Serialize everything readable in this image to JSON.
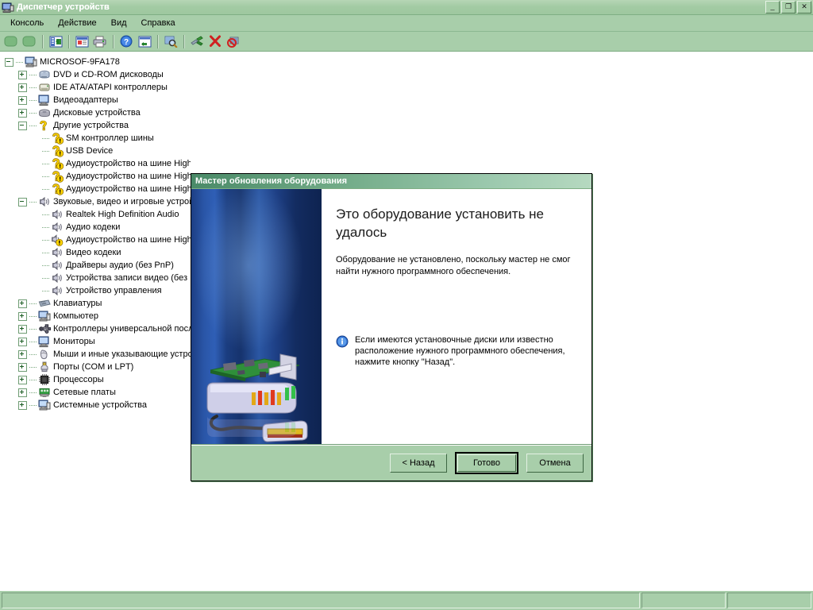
{
  "window": {
    "title": "Диспетчер устройств",
    "icon": "device-manager-icon",
    "buttons": {
      "minimize": "_",
      "restore": "❐",
      "close": "✕"
    }
  },
  "menubar": {
    "items": [
      {
        "label": "Консоль"
      },
      {
        "label": "Действие"
      },
      {
        "label": "Вид"
      },
      {
        "label": "Справка"
      }
    ]
  },
  "toolbar": {
    "buttons": [
      {
        "name": "back-button",
        "icon": "back-arrow-icon"
      },
      {
        "name": "forward-button",
        "icon": "forward-arrow-icon"
      },
      {
        "name": "show-console-tree-button",
        "icon": "console-tree-icon"
      },
      {
        "name": "properties-button",
        "icon": "properties-icon"
      },
      {
        "name": "print-button",
        "icon": "printer-icon"
      },
      {
        "name": "help-button",
        "icon": "help-icon"
      },
      {
        "name": "refresh-view-button",
        "icon": "refresh-view-icon"
      },
      {
        "name": "scan-hardware-button",
        "icon": "scan-hardware-icon"
      },
      {
        "name": "update-driver-button",
        "icon": "update-driver-icon"
      },
      {
        "name": "uninstall-button",
        "icon": "red-x-icon"
      },
      {
        "name": "disable-button",
        "icon": "disable-icon"
      }
    ]
  },
  "tree": {
    "root": {
      "label": "MICROSOF-9FA178",
      "icon": "computer-icon",
      "expanded": true
    },
    "nodes": [
      {
        "label": "DVD и CD-ROM дисководы",
        "icon": "cdrom-icon",
        "level": 1,
        "expander": "plus"
      },
      {
        "label": "IDE ATA/ATAPI контроллеры",
        "icon": "ide-icon",
        "level": 1,
        "expander": "plus"
      },
      {
        "label": "Видеоадаптеры",
        "icon": "display-icon",
        "level": 1,
        "expander": "plus"
      },
      {
        "label": "Дисковые устройства",
        "icon": "disk-icon",
        "level": 1,
        "expander": "plus"
      },
      {
        "label": "Другие устройства",
        "icon": "unknown-device-icon",
        "level": 1,
        "expander": "minus"
      },
      {
        "label": "SM контроллер шины",
        "icon": "warning-device-icon",
        "level": 2,
        "expander": "none"
      },
      {
        "label": "USB Device",
        "icon": "warning-device-icon",
        "level": 2,
        "expander": "none"
      },
      {
        "label": "Аудиоустройство на шине High I",
        "icon": "warning-device-icon",
        "level": 2,
        "expander": "none"
      },
      {
        "label": "Аудиоустройство на шине High I",
        "icon": "warning-device-icon",
        "level": 2,
        "expander": "none"
      },
      {
        "label": "Аудиоустройство на шине High I",
        "icon": "warning-device-icon",
        "level": 2,
        "expander": "none"
      },
      {
        "label": "Звуковые, видео и игровые устрой",
        "icon": "sound-icon",
        "level": 1,
        "expander": "minus"
      },
      {
        "label": "Realtek High Definition Audio",
        "icon": "sound-icon",
        "level": 2,
        "expander": "none"
      },
      {
        "label": "Аудио кодеки",
        "icon": "sound-icon",
        "level": 2,
        "expander": "none"
      },
      {
        "label": "Аудиоустройство на шине High I",
        "icon": "sound-warning-icon",
        "level": 2,
        "expander": "none"
      },
      {
        "label": "Видео кодеки",
        "icon": "sound-icon",
        "level": 2,
        "expander": "none"
      },
      {
        "label": "Драйверы аудио (без PnP)",
        "icon": "sound-icon",
        "level": 2,
        "expander": "none"
      },
      {
        "label": "Устройства записи видео (без I",
        "icon": "sound-icon",
        "level": 2,
        "expander": "none"
      },
      {
        "label": "Устройство управления",
        "icon": "sound-icon",
        "level": 2,
        "expander": "none"
      },
      {
        "label": "Клавиатуры",
        "icon": "keyboard-icon",
        "level": 1,
        "expander": "plus"
      },
      {
        "label": "Компьютер",
        "icon": "computer-icon",
        "level": 1,
        "expander": "plus"
      },
      {
        "label": "Контроллеры универсальной после",
        "icon": "usb-icon",
        "level": 1,
        "expander": "plus"
      },
      {
        "label": "Мониторы",
        "icon": "monitor-icon",
        "level": 1,
        "expander": "plus"
      },
      {
        "label": "Мыши и иные указывающие устрой",
        "icon": "mouse-icon",
        "level": 1,
        "expander": "plus"
      },
      {
        "label": "Порты (COM и LPT)",
        "icon": "port-icon",
        "level": 1,
        "expander": "plus"
      },
      {
        "label": "Процессоры",
        "icon": "processor-icon",
        "level": 1,
        "expander": "plus"
      },
      {
        "label": "Сетевые платы",
        "icon": "network-icon",
        "level": 1,
        "expander": "plus"
      },
      {
        "label": "Системные устройства",
        "icon": "system-device-icon",
        "level": 1,
        "expander": "plus"
      }
    ]
  },
  "dialog": {
    "title": "Мастер обновления оборудования",
    "heading": "Это оборудование установить не удалось",
    "paragraph": "Оборудование не установлено, поскольку мастер не смог найти нужного программного обеспечения.",
    "note_icon": "info-icon",
    "note": "Если имеются установочные диски или известно расположение нужного программного обеспечения, нажмите кнопку \"Назад\".",
    "buttons": {
      "back": "< Назад",
      "finish": "Готово",
      "cancel": "Отмена"
    }
  },
  "statusbar": {
    "main": "",
    "pane2": "",
    "pane3": ""
  },
  "colors": {
    "window_face": "#a8ceaa",
    "title_text": "#ffffff",
    "tree_bg": "#ffffff",
    "banner_blue": "#1d3f84",
    "warning_yellow": "#ffd800",
    "accent_green": "#4a8a68"
  }
}
